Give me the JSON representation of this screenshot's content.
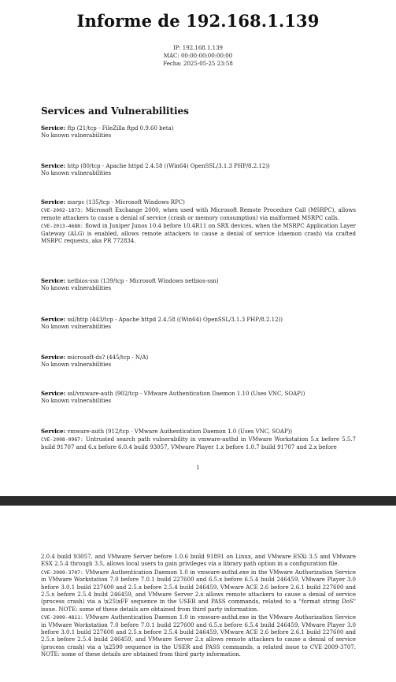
{
  "title": "Informe de 192.168.1.139",
  "meta": {
    "ip": "IP: 192.168.1.139",
    "mac": "MAC: 00:00:00:00:00:00",
    "fecha": "Fecha: 2025-05-25 23:58"
  },
  "section_title": "Services and Vulnerabilities",
  "service_label": "Service:",
  "services": [
    {
      "desc": "ftp (21/tcp - FileZilla ftpd 0.9.60 beta)",
      "note": "No known vulnerabilities"
    },
    {
      "desc": "http (80/tcp - Apache httpd 2.4.58 ((Win64) OpenSSL/3.1.3 PHP/8.2.12))",
      "note": "No known vulnerabilities"
    },
    {
      "desc": "msrpc (135/tcp - Microsoft Windows RPC)",
      "cves": [
        {
          "id": "CVE-2002-1873:",
          "text": "Microsoft Exchange 2000, when used with Microsoft Remote Procedure Call (MSRPC), allows remote attackers to cause a denial of service (crash or memory consumption) via malformed MSRPC calls."
        },
        {
          "id": "CVE-2013-4688:",
          "text": "flowd in Juniper Junos 10.4 before 10.4R11 on SRX devices, when the MSRPC Application Layer Gateway (ALG) is enabled, allows remote attackers to cause a denial of service (daemon crash) via crafted MSRPC requests, aka PR 772834."
        }
      ]
    },
    {
      "desc": "netbios-ssn (139/tcp - Microsoft Windows netbios-ssn)",
      "note": "No known vulnerabilities"
    },
    {
      "desc": "ssl/http (443/tcp - Apache httpd 2.4.58 ((Win64) OpenSSL/3.1.3 PHP/8.2.12))",
      "note": "No known vulnerabilities"
    },
    {
      "desc": "microsoft-ds? (445/tcp - N/A)",
      "note": "No known vulnerabilities"
    },
    {
      "desc": "ssl/vmware-auth (902/tcp - VMware Authentication Daemon 1.10 (Uses VNC, SOAP))",
      "note": "No known vulnerabilities"
    },
    {
      "desc": "vmware-auth (912/tcp - VMware Authentication Daemon 1.0 (Uses VNC, SOAP))",
      "cves": [
        {
          "id": "CVE-2008-0967:",
          "text": "Untrusted search path vulnerability in vmware-authd in VMware Workstation 5.x before 5.5.7 build 91707 and 6.x before 6.0.4 build 93057, VMware Player 1.x before 1.0.7 build 91707 and 2.x before"
        }
      ]
    }
  ],
  "page_number": "1",
  "page2": {
    "continuation": "2.0.4 build 93057, and VMware Server before 1.0.6 build 91891 on Linux, and VMware ESXi 3.5 and VMware ESX 2.5.4 through 3.5, allows local users to gain privileges via a library path option in a configuration file.",
    "cves": [
      {
        "id": "CVE-2009-3707:",
        "text": "VMware Authentication Daemon 1.0 in vmware-authd.exe in the VMware Authorization Service in VMware Workstation 7.0 before 7.0.1 build 227600 and 6.5.x before 6.5.4 build 246459, VMware Player 3.0 before 3.0.1 build 227600 and 2.5.x before 2.5.4 build 246459, VMware ACE 2.6 before 2.6.1 build 227600 and 2.5.x before 2.5.4 build 246459, and VMware Server 2.x allows remote attackers to cause a denial of service (process crash) via a \\x25\\xFF sequence in the USER and PASS commands, related to a \"format string DoS\" issue. NOTE: some of these details are obtained from third party information."
      },
      {
        "id": "CVE-2009-4811:",
        "text": "VMware Authentication Daemon 1.0 in vmware-authd.exe in the VMware Authorization Service in VMware Workstation 7.0 before 7.0.1 build 227600 and 6.5.x before 6.5.4 build 246459, VMware Player 3.0 before 3.0.1 build 227600 and 2.5.x before 2.5.4 build 246459, VMware ACE 2.6 before 2.6.1 build 227600 and 2.5.x before 2.5.4 build 246459, and VMware Server 2.x allows remote attackers to cause a denial of service (process crash) via a \\x2590 sequence in the USER and PASS commands, a related issue to CVE-2009-3707. NOTE: some of these details are obtained from third party information."
      }
    ]
  }
}
